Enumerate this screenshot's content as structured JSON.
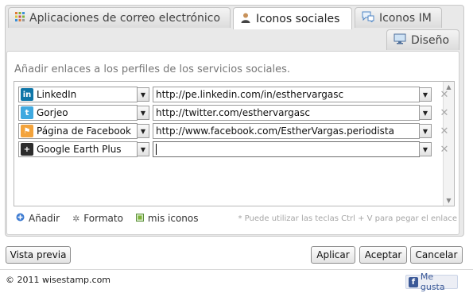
{
  "tabs": [
    {
      "label": "Aplicaciones de correo electrónico",
      "icon": "apps-grid-icon"
    },
    {
      "label": "Iconos sociales",
      "icon": "user-icon",
      "active": true
    },
    {
      "label": "Iconos IM",
      "icon": "chat-bubble-icon"
    },
    {
      "label": "Diseño",
      "icon": "monitor-icon"
    }
  ],
  "intro": "Añadir enlaces a los perfiles de los servicios sociales.",
  "rows": [
    {
      "service": "LinkedIn",
      "icon": "linkedin-icon",
      "url": "http://pe.linkedin.com/in/esthervargasc"
    },
    {
      "service": "Gorjeo",
      "icon": "twitter-icon",
      "url": "http://twitter.com/esthervargasc"
    },
    {
      "service": "Página de Facebook",
      "icon": "facebook-page-icon",
      "url": "http://www.facebook.com/EstherVargas.periodista"
    },
    {
      "service": "Google Earth Plus",
      "icon": "google-plus-icon",
      "url": ""
    }
  ],
  "toolbar": {
    "add": "Añadir",
    "format": "Formato",
    "my_icons": "mis iconos",
    "hint": "* Puede utilizar las teclas Ctrl + V para pegar el enlace"
  },
  "buttons": {
    "preview": "Vista previa",
    "apply": "Aplicar",
    "accept": "Aceptar",
    "cancel": "Cancelar"
  },
  "footer": {
    "copyright": "© 2011 wisestamp.com",
    "like": "Me gusta"
  },
  "colors": {
    "linkedin": "#0e76a8",
    "twitter": "#3fa9e0",
    "facebook": "#f3a33b",
    "google_plus": "#2b2b2b",
    "fb_blue": "#3b5998"
  }
}
